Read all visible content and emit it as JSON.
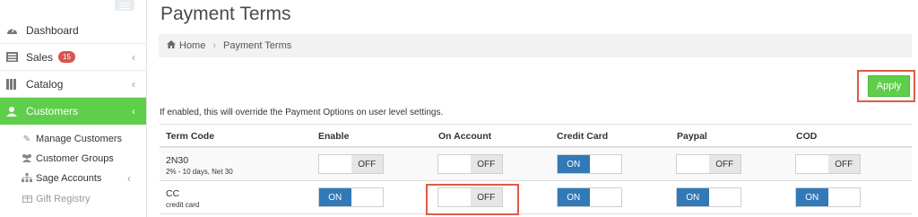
{
  "sidebar": {
    "items": [
      {
        "label": "Dashboard",
        "icon": "dashboard-icon"
      },
      {
        "label": "Sales",
        "badge": "15",
        "icon": "sales-icon",
        "chevron": "‹"
      },
      {
        "label": "Catalog",
        "icon": "catalog-icon",
        "chevron": "‹"
      },
      {
        "label": "Customers",
        "icon": "customers-icon",
        "chevron": "‹",
        "active": true
      }
    ],
    "sub_items": [
      {
        "label": "Manage Customers",
        "icon": "edit-icon"
      },
      {
        "label": "Customer Groups",
        "icon": "users-icon"
      },
      {
        "label": "Sage Accounts",
        "icon": "sitemap-icon",
        "chevron": "‹"
      },
      {
        "label": "Gift Registry",
        "icon": "gift-icon"
      }
    ]
  },
  "page": {
    "title": "Payment Terms",
    "breadcrumb": {
      "home": "Home",
      "current": "Payment Terms"
    },
    "apply_label": "Apply",
    "note": "If enabled, this will override the Payment Options on user level settings."
  },
  "table": {
    "headers": [
      "Term Code",
      "Enable",
      "On Account",
      "Credit Card",
      "Paypal",
      "COD"
    ],
    "toggle_on_label": "ON",
    "toggle_off_label": "OFF",
    "rows": [
      {
        "code": "2N30",
        "desc": "2% - 10 days, Net 30",
        "enable": "OFF",
        "on_account": "OFF",
        "credit_card": "ON",
        "paypal": "OFF",
        "cod": "OFF"
      },
      {
        "code": "CC",
        "desc": "credit card",
        "enable": "ON",
        "on_account": "OFF",
        "credit_card": "ON",
        "paypal": "ON",
        "cod": "ON"
      }
    ]
  },
  "colors": {
    "accent_green": "#5fce4b",
    "toggle_on_blue": "#3279b7",
    "badge_red": "#d9534f",
    "highlight_red": "#e05a45"
  }
}
